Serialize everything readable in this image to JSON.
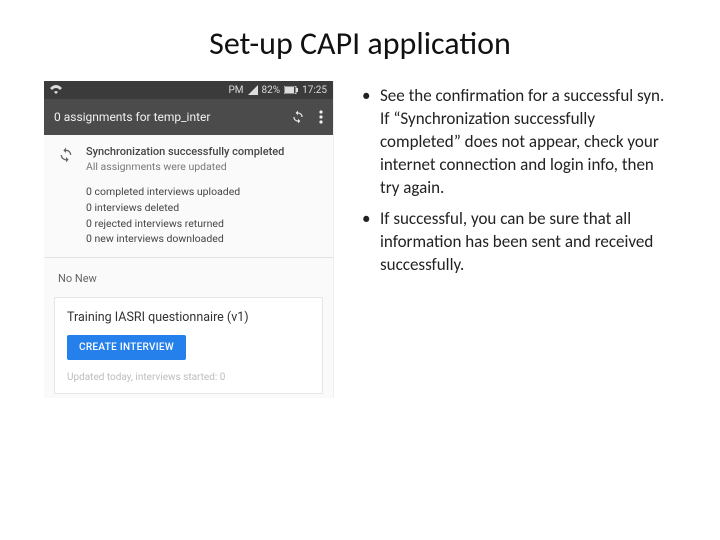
{
  "title": "Set-up CAPI application",
  "phone": {
    "statusbar": {
      "carrier": "",
      "signal_text": "PM",
      "battery_text": "82%",
      "time": "17:25"
    },
    "appbar": {
      "title": "0 assignments for temp_inter"
    },
    "sync_banner": {
      "line1": "Synchronization successfully completed",
      "line2": "All assignments were updated"
    },
    "stats": [
      "0 completed interviews uploaded",
      "0 interviews deleted",
      "0 rejected interviews returned",
      "0 new interviews downloaded"
    ],
    "no_new_label": "No New",
    "card": {
      "title": "Training IASRI questionnaire (v1)",
      "button": "CREATE INTERVIEW",
      "meta": "Updated today, interviews started: 0"
    }
  },
  "bullets": [
    "See the confirmation for a successful syn. If “Synchronization successfully completed” does not appear, check your internet connection and login info, then try again.",
    "If successful, you can be sure that all information has been sent and received successfully."
  ]
}
